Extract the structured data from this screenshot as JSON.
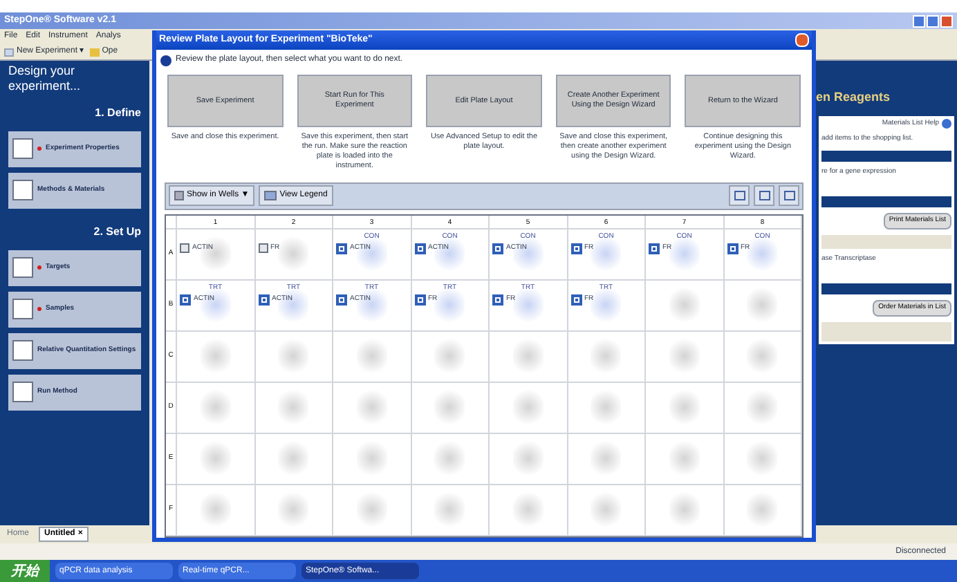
{
  "app_window": {
    "title": "StepOne® Software v2.1"
  },
  "menu": [
    "File",
    "Edit",
    "Instrument",
    "Analys"
  ],
  "toolbar": {
    "new_experiment": "New Experiment",
    "new_arrow": "▾",
    "open": "Ope"
  },
  "sidebar": {
    "heading": "Design your experiment...",
    "sections": [
      {
        "title": "1. Define",
        "items": [
          {
            "label": "Experiment Properties",
            "required": true
          },
          {
            "label": "Methods & Materials",
            "required": false
          }
        ]
      },
      {
        "title": "2. Set Up",
        "items": [
          {
            "label": "Targets",
            "required": true
          },
          {
            "label": "Samples",
            "required": true
          },
          {
            "label": "Relative Quantitation Settings",
            "required": false
          },
          {
            "label": "Run Method",
            "required": false
          }
        ]
      }
    ]
  },
  "dialog": {
    "title": "Review Plate Layout for Experiment \"BioTeke\"",
    "instruction": "Review the plate layout, then select what you want to do next.",
    "actions": [
      {
        "label": "Save Experiment",
        "description": "Save and close this experiment."
      },
      {
        "label": "Start Run for This Experiment",
        "description": "Save this experiment, then start the run. Make sure the reaction plate is loaded into the instrument."
      },
      {
        "label": "Edit Plate Layout",
        "description": "Use Advanced Setup to edit the plate layout."
      },
      {
        "label": "Create Another Experiment Using the Design Wizard",
        "description": "Save and close this experiment, then create another experiment using the Design Wizard."
      },
      {
        "label": "Return to the Wizard",
        "description": "Continue designing this experiment using the Design Wizard."
      }
    ],
    "show_in": "Show in Wells",
    "show_in_arrow": "▼",
    "legend": "View Legend",
    "plate": {
      "columns": [
        "1",
        "2",
        "3",
        "4",
        "5",
        "6",
        "7",
        "8"
      ],
      "rows": [
        {
          "label": "A",
          "wells": [
            {
              "kind": "unknown",
              "target": "ACTIN"
            },
            {
              "kind": "unknown",
              "target": "FR"
            },
            {
              "kind": "target",
              "task": "CON",
              "target": "ACTIN"
            },
            {
              "kind": "target",
              "task": "CON",
              "target": "ACTIN"
            },
            {
              "kind": "target",
              "task": "CON",
              "target": "ACTIN"
            },
            {
              "kind": "target",
              "task": "CON",
              "target": "FR"
            },
            {
              "kind": "target",
              "task": "CON",
              "target": "FR"
            },
            {
              "kind": "target",
              "task": "CON",
              "target": "FR"
            }
          ]
        },
        {
          "label": "B",
          "wells": [
            {
              "kind": "target",
              "task": "TRT",
              "target": "ACTIN"
            },
            {
              "kind": "target",
              "task": "TRT",
              "target": "ACTIN"
            },
            {
              "kind": "target",
              "task": "TRT",
              "target": "ACTIN"
            },
            {
              "kind": "target",
              "task": "TRT",
              "target": "FR"
            },
            {
              "kind": "target",
              "task": "TRT",
              "target": "FR"
            },
            {
              "kind": "target",
              "task": "TRT",
              "target": "FR"
            },
            {
              "kind": "empty"
            },
            {
              "kind": "empty"
            }
          ]
        },
        {
          "label": "C",
          "wells": [
            {
              "kind": "empty"
            },
            {
              "kind": "empty"
            },
            {
              "kind": "empty"
            },
            {
              "kind": "empty"
            },
            {
              "kind": "empty"
            },
            {
              "kind": "empty"
            },
            {
              "kind": "empty"
            },
            {
              "kind": "empty"
            }
          ]
        },
        {
          "label": "D",
          "wells": [
            {
              "kind": "empty"
            },
            {
              "kind": "empty"
            },
            {
              "kind": "empty"
            },
            {
              "kind": "empty"
            },
            {
              "kind": "empty"
            },
            {
              "kind": "empty"
            },
            {
              "kind": "empty"
            },
            {
              "kind": "empty"
            }
          ]
        },
        {
          "label": "E",
          "wells": [
            {
              "kind": "empty"
            },
            {
              "kind": "empty"
            },
            {
              "kind": "empty"
            },
            {
              "kind": "empty"
            },
            {
              "kind": "empty"
            },
            {
              "kind": "empty"
            },
            {
              "kind": "empty"
            },
            {
              "kind": "empty"
            }
          ]
        },
        {
          "label": "F",
          "wells": [
            {
              "kind": "empty"
            },
            {
              "kind": "empty"
            },
            {
              "kind": "empty"
            },
            {
              "kind": "empty"
            },
            {
              "kind": "empty"
            },
            {
              "kind": "empty"
            },
            {
              "kind": "empty"
            },
            {
              "kind": "empty"
            }
          ]
        }
      ]
    }
  },
  "materials": {
    "heading": "en Reagents",
    "help": "Materials List Help",
    "note": "add items to the shopping list.",
    "panel_text": "re for a gene expression",
    "print": "Print Materials List",
    "list_item": "ase Transcriptase",
    "order": "Order Materials in List"
  },
  "bottom_tabs": [
    {
      "label": "Home",
      "selected": false
    },
    {
      "label": "Untitled",
      "selected": true,
      "close": "×"
    }
  ],
  "status": "Disconnected",
  "taskbar": {
    "start": "开始",
    "tasks": [
      {
        "label": "qPCR data analysis",
        "selected": false
      },
      {
        "label": "Real-time qPCR...",
        "selected": false
      },
      {
        "label": "StepOne® Softwa...",
        "selected": true
      }
    ]
  }
}
